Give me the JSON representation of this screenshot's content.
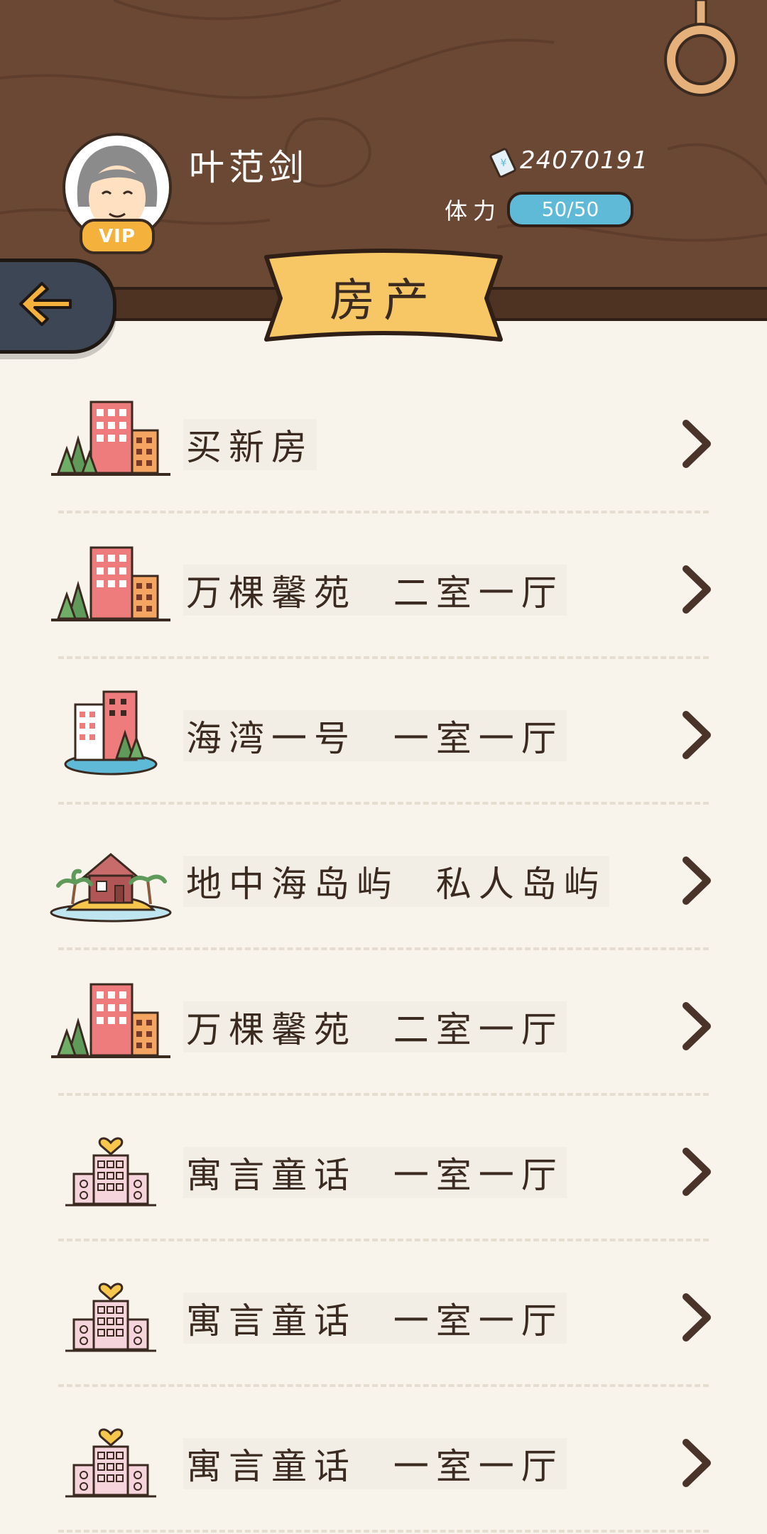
{
  "header": {
    "username": "叶范剑",
    "vip_label": "VIP",
    "coins": "24070191",
    "stamina_label": "体力",
    "stamina_value": "50/50"
  },
  "page_title": "房产",
  "properties": [
    {
      "label": "买新房",
      "icon": "buy-house-icon"
    },
    {
      "label": "万棵馨苑  二室一厅",
      "icon": "apartment-trees-icon"
    },
    {
      "label": "海湾一号  一室一厅",
      "icon": "bay-apartment-icon"
    },
    {
      "label": "地中海岛屿  私人岛屿",
      "icon": "island-house-icon"
    },
    {
      "label": "万棵馨苑  二室一厅",
      "icon": "apartment-trees-icon"
    },
    {
      "label": "寓言童话  一室一厅",
      "icon": "fairy-tower-icon"
    },
    {
      "label": "寓言童话  一室一厅",
      "icon": "fairy-tower-icon"
    },
    {
      "label": "寓言童话  一室一厅",
      "icon": "fairy-tower-icon"
    }
  ],
  "colors": {
    "wood": "#6b4834",
    "banner": "#f7c766",
    "stamina": "#5ebad7",
    "vip": "#f4b23d",
    "background": "#f8f4ec"
  }
}
